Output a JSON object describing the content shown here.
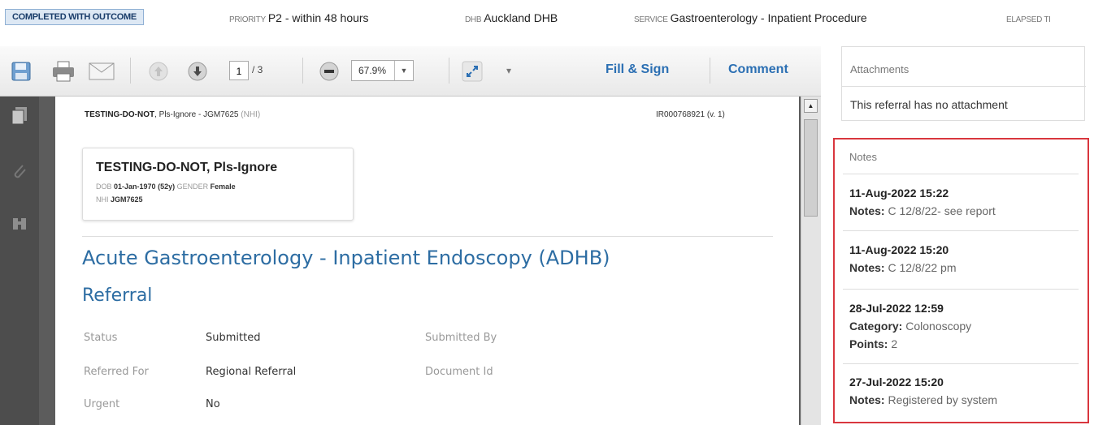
{
  "topbar": {
    "status": "COMPLETED WITH OUTCOME",
    "priority_label": "PRIORITY",
    "priority_value": "P2 - within 48 hours",
    "dhb_label": "DHB",
    "dhb_value": "Auckland DHB",
    "service_label": "SERVICE",
    "service_value": "Gastroenterology - Inpatient Procedure",
    "elapsed_label": "ELAPSED TI"
  },
  "toolbar": {
    "page_current": "1",
    "page_total": "/ 3",
    "zoom": "67.9%",
    "fill_sign": "Fill & Sign",
    "comment": "Comment"
  },
  "document": {
    "header_name": "TESTING-DO-NOT",
    "header_rest": ", Pls-Ignore - JGM7625 ",
    "header_nhi": "(NHI)",
    "header_id": "IR000768921 (v. 1)",
    "patient": {
      "name": "TESTING-DO-NOT, Pls-Ignore",
      "dob_label": "DOB",
      "dob_value": "01-Jan-1970 (52y)",
      "gender_label": "GENDER",
      "gender_value": "Female",
      "nhi_label": "NHI",
      "nhi_value": "JGM7625"
    },
    "title": "Acute Gastroenterology - Inpatient Endoscopy (ADHB)",
    "subtitle": "Referral",
    "fields": {
      "status_label": "Status",
      "status_value": "Submitted",
      "submitted_by_label": "Submitted By",
      "referred_for_label": "Referred For",
      "referred_for_value": "Regional Referral",
      "document_id_label": "Document Id",
      "urgent_label": "Urgent",
      "urgent_value": "No"
    }
  },
  "attachments": {
    "title": "Attachments",
    "empty_text": "This referral has no attachment"
  },
  "notes": {
    "title": "Notes",
    "items": [
      {
        "date": "11-Aug-2022 15:22",
        "label1": "Notes:",
        "text1": " C 12/8/22- see report"
      },
      {
        "date": "11-Aug-2022 15:20",
        "label1": "Notes:",
        "text1": " C 12/8/22 pm"
      },
      {
        "date": "28-Jul-2022 12:59",
        "label1": "Category:",
        "text1": " Colonoscopy",
        "label2": "Points:",
        "text2": " 2"
      },
      {
        "date": "27-Jul-2022 15:20",
        "label1": "Notes:",
        "text1": " Registered by system"
      }
    ]
  },
  "colors": {
    "accent_blue": "#2b6fb3",
    "title_blue": "#2d6da3",
    "notes_border": "#d9363e"
  },
  "icons": [
    "save-icon",
    "print-icon",
    "email-icon",
    "previous-page-icon",
    "next-page-icon",
    "zoom-out-icon",
    "zoom-dropdown-icon",
    "expand-icon",
    "more-icon",
    "pages-icon",
    "attachment-clip-icon",
    "bookmarks-icon"
  ]
}
